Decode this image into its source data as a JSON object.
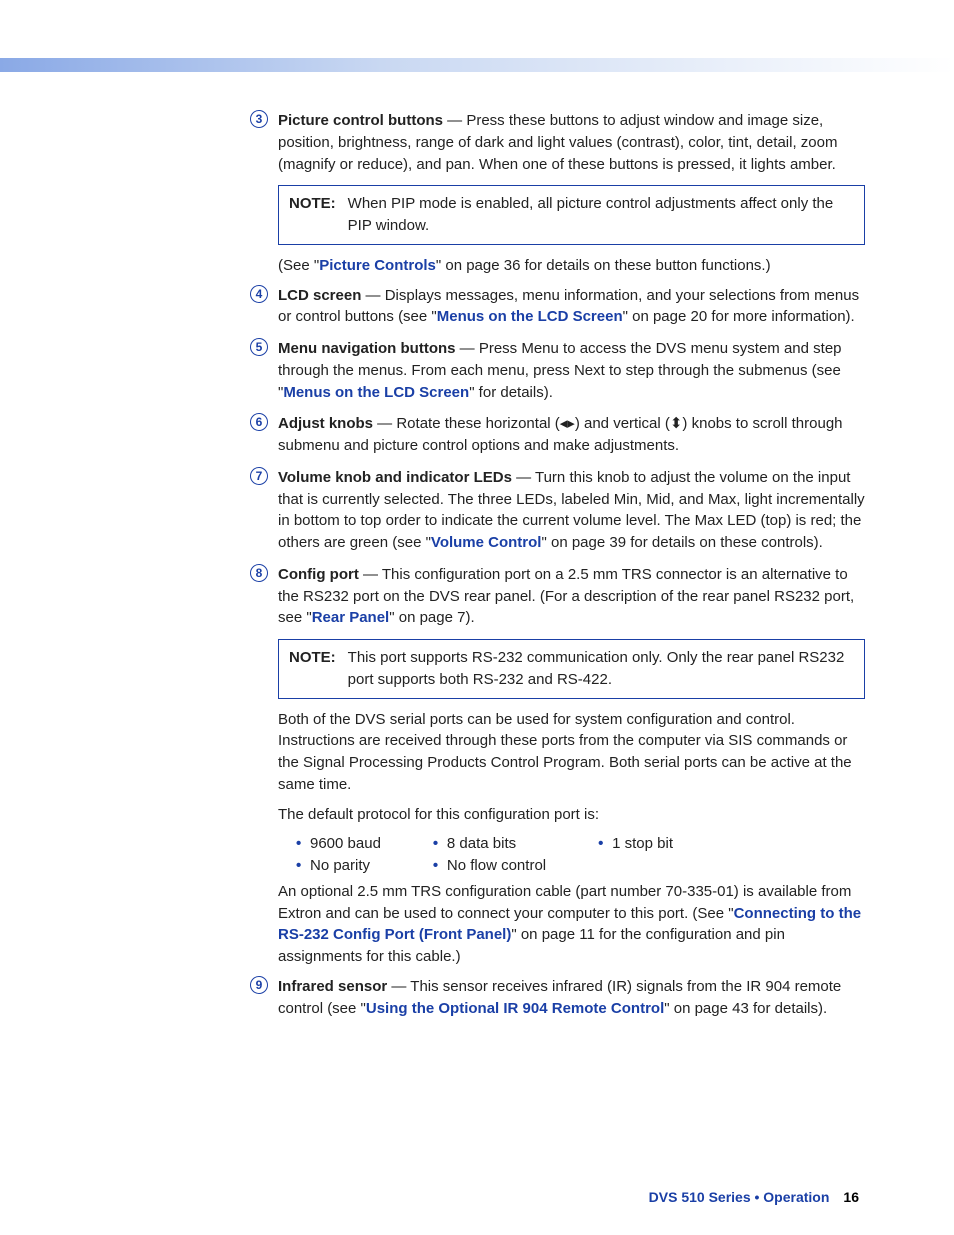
{
  "items": [
    {
      "num": "3",
      "title": "Picture control buttons",
      "text": " — Press these buttons to adjust window and image size, position, brightness, range of dark and light values (contrast), color, tint, detail, zoom (magnify or reduce), and pan. When one of these buttons is pressed, it lights amber."
    },
    {
      "num": "4",
      "title": "LCD screen",
      "text_pre": " — Displays messages, menu information, and your selections from menus or control buttons (see \"",
      "link": "Menus on the LCD Screen",
      "text_post": "\" on page 20 for more information)."
    },
    {
      "num": "5",
      "title": "Menu navigation buttons",
      "text_pre": " — Press Menu to access the DVS menu system and step through the menus. From each menu, press Next to step through the submenus (see \"",
      "link": "Menus on the LCD Screen",
      "text_post": "\" for details)."
    },
    {
      "num": "6",
      "title": "Adjust knobs",
      "text": " — Rotate these horizontal (◂▸) and vertical (⬍) knobs to scroll through submenu and picture control options and make adjustments."
    },
    {
      "num": "7",
      "title": "Volume knob and indicator LEDs",
      "text_pre": " — Turn this knob to adjust the volume on the input that is currently selected. The three LEDs, labeled Min, Mid, and Max, light incrementally in bottom to top order to indicate the current volume level. The Max LED (top) is red; the others are green (see \"",
      "link": "Volume Control",
      "text_post": "\" on page 39 for details on these controls)."
    },
    {
      "num": "8",
      "title": "Config port",
      "text_pre": " — This configuration port on a 2.5 mm TRS connector is an alternative to the RS232 port on the DVS rear panel. (For a description of the rear panel RS232 port, see \"",
      "link": "Rear Panel",
      "text_post": "\" on page 7)."
    },
    {
      "num": "9",
      "title": "Infrared sensor",
      "text_pre": " — This sensor receives infrared (IR) signals from the IR 904 remote control (see \"",
      "link": "Using the Optional IR 904 Remote Control",
      "text_post": "\" on page 43 for details)."
    }
  ],
  "notes": {
    "pip": {
      "label": "NOTE:",
      "text": "When PIP mode is enabled, all picture control adjustments affect only the PIP window."
    },
    "rs232": {
      "label": "NOTE:",
      "text": "This port supports RS-232 communication only. Only the rear panel RS232 port supports both RS-232 and RS-422."
    }
  },
  "see_picture": {
    "pre": "(See \"",
    "link": "Picture Controls",
    "post": "\" on page 36 for details on these button functions.)"
  },
  "config_follow": {
    "p1": "Both of the DVS serial ports can be used for system configuration and control. Instructions are received through these ports from the computer via SIS commands or the Signal Processing Products Control Program.  Both serial ports can be active at the same time.",
    "p2": "The default protocol for this configuration port is:",
    "bullets_col1": [
      "9600 baud",
      "No parity"
    ],
    "bullets_col2": [
      "8 data bits",
      "No flow control"
    ],
    "bullets_col3": [
      "1 stop bit"
    ],
    "p3_pre": "An optional 2.5 mm TRS configuration cable (part number 70-335-01) is available from Extron and can be used to connect your computer to this port. (See \"",
    "p3_link": "Connecting to the RS-232 Config Port (Front Panel)",
    "p3_post": "\" on page 11 for the configuration and pin assignments for this cable.)"
  },
  "footer": {
    "text": "DVS 510 Series • Operation",
    "page": "16"
  }
}
